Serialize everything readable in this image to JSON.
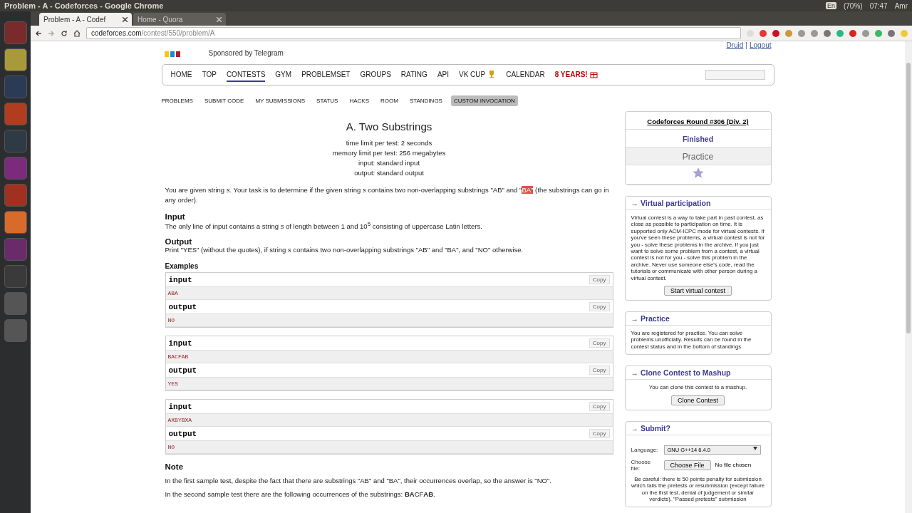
{
  "system_bar": {
    "title": "Problem - A - Codeforces - Google Chrome",
    "keyboard": "En",
    "battery": "(70%)",
    "time": "07:47",
    "user": "Amr"
  },
  "browser": {
    "tabs": [
      {
        "title": "Problem - A - Codef",
        "selected": true
      },
      {
        "title": "Home - Quora",
        "selected": false
      }
    ],
    "url_host": "codeforces.com",
    "url_path": "/contest/550/problem/A"
  },
  "header": {
    "user_links": [
      "Druid",
      "Logout"
    ],
    "separator": "|",
    "sponsor": "Sponsored by Telegram"
  },
  "nav": [
    {
      "label": "HOME",
      "selected": false,
      "kind": "plain"
    },
    {
      "label": "TOP",
      "selected": false,
      "kind": "plain"
    },
    {
      "label": "CONTESTS",
      "selected": true,
      "kind": "plain"
    },
    {
      "label": "GYM",
      "selected": false,
      "kind": "plain"
    },
    {
      "label": "PROBLEMSET",
      "selected": false,
      "kind": "plain"
    },
    {
      "label": "GROUPS",
      "selected": false,
      "kind": "plain"
    },
    {
      "label": "RATING",
      "selected": false,
      "kind": "plain"
    },
    {
      "label": "API",
      "selected": false,
      "kind": "plain"
    },
    {
      "label": "VK CUP",
      "selected": false,
      "kind": "trophy"
    },
    {
      "label": "CALENDAR",
      "selected": false,
      "kind": "plain"
    },
    {
      "label": "8 YEARS!",
      "selected": false,
      "kind": "gift"
    }
  ],
  "subnav": [
    {
      "label": "PROBLEMS",
      "selected": false
    },
    {
      "label": "SUBMIT CODE",
      "selected": false
    },
    {
      "label": "MY SUBMISSIONS",
      "selected": false
    },
    {
      "label": "STATUS",
      "selected": false
    },
    {
      "label": "HACKS",
      "selected": false
    },
    {
      "label": "ROOM",
      "selected": false
    },
    {
      "label": "STANDINGS",
      "selected": false
    },
    {
      "label": "CUSTOM INVOCATION",
      "selected": true
    }
  ],
  "problem": {
    "title": "A. Two Substrings",
    "limits": [
      "time limit per test: 2 seconds",
      "memory limit per test: 256 megabytes",
      "input: standard input",
      "output: standard output"
    ],
    "statement": [
      {
        "text": "You are given string *s*. Your task is to determine if the given string *s* contains two non-overlapping substrings \"AB\" and \"",
        "highlighted": false
      },
      {
        "text": "BA\"",
        "highlighted": true
      },
      {
        "text": " (the substrings can go in any order).",
        "highlighted": false
      }
    ],
    "sections": [
      {
        "title": "Input",
        "text": "The only line of input contains a string *s* of length between 1 and 10$^{5}$ consisting of uppercase Latin letters."
      },
      {
        "title": "Output",
        "text": "Print \"YES\" (without the quotes), if string *s* contains two non-overlapping substrings \"AB\" and \"BA\", and \"NO\" otherwise."
      }
    ],
    "examples_title": "Examples",
    "examples": [
      {
        "input_label": "input",
        "input": "ABA",
        "output_label": "output",
        "output": "NO",
        "copy": [
          "Copy",
          "Copy"
        ]
      },
      {
        "input_label": "input",
        "input": "BACFAB",
        "output_label": "output",
        "output": "YES",
        "copy": [
          "Copy",
          "Copy"
        ]
      },
      {
        "input_label": "input",
        "input": "AXBYBXA",
        "output_label": "output",
        "output": "NO",
        "copy": [
          "Copy",
          "Copy"
        ]
      }
    ],
    "note": {
      "title": "Note",
      "paragraphs": [
        "In the first sample test, despite the fact that there are substrings \"AB\" and \"BA\", their occurrences overlap, so the answer is \"NO\".",
        "In the second sample test there are the following occurrences of the substrings: **BA**CF**AB**."
      ]
    }
  },
  "sidebar": {
    "round": {
      "title": "Codeforces Round #306 (Div. 2)",
      "status": "Finished",
      "phase": "Practice"
    },
    "boxes": [
      {
        "kind": "info",
        "title": "→ Virtual participation",
        "text": "Virtual contest is a way to take part in past contest, as close as possible to participation on time. It is supported only ACM-ICPC mode for virtual contests. If you've seen these problems, a virtual contest is not for you - solve these problems in the archive. If you just want to solve some problem from a contest, a virtual contest is not for you - solve this problem in the archive. Never use someone else's code, read the tutorials or communicate with other person during a virtual contest.",
        "button": "Start virtual contest"
      },
      {
        "kind": "info",
        "title": "→ Practice",
        "text": "You are registered for practice. You can solve problems unofficially. Results can be found in the contest status and in the bottom of standings."
      },
      {
        "kind": "info",
        "title": "→ Clone Contest to Mashup",
        "text": "You can clone this contest to a mashup.",
        "button": "Clone Contest"
      },
      {
        "kind": "submit",
        "title": "→ Submit?",
        "language_label": "Language:",
        "language": "GNU G++14 6.4.0",
        "file_label": "Choose file:",
        "file_button": "Choose File",
        "file_status": "No file chosen",
        "warning": "Be careful: there is 50 points penalty for submission which fails the pretests or resubmission (except failure on the first test, denial of judgement or similar verdicts). \"Passed pretests\" submission"
      }
    ]
  }
}
